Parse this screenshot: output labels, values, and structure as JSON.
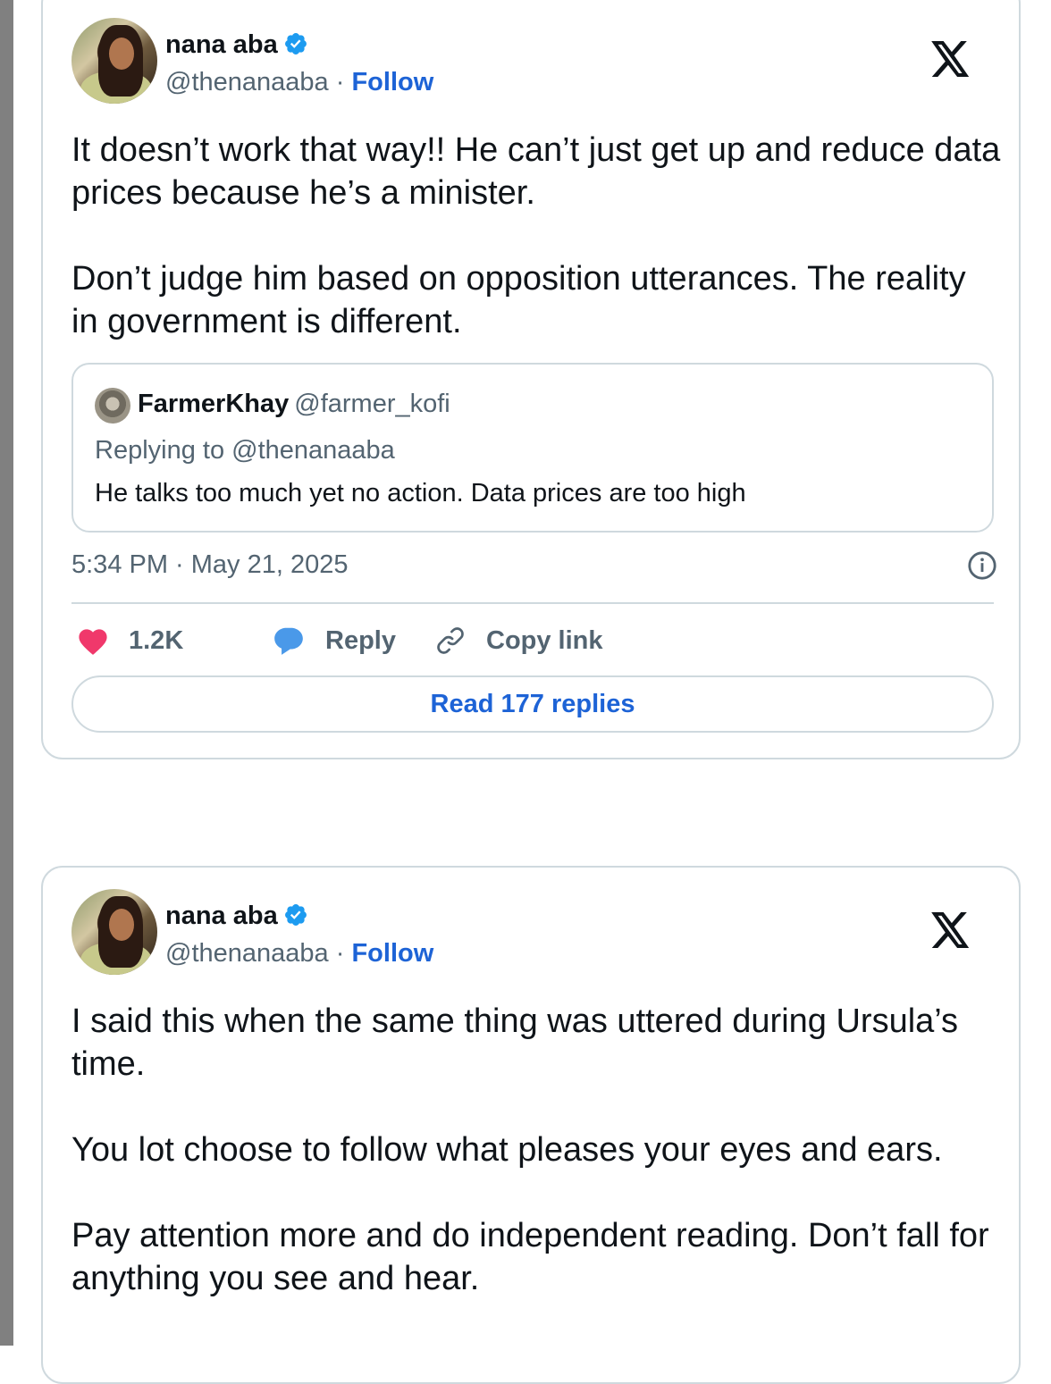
{
  "colors": {
    "link": "#1d63d6",
    "like": "#f0386b",
    "reply_bubble": "#4a99e9",
    "muted": "#536471"
  },
  "tweets": [
    {
      "author_name": "nana aba",
      "handle": "@thenanaaba",
      "separator": "·",
      "follow_label": "Follow",
      "paragraphs": [
        "It doesn’t work that way!! He can’t just get up and reduce data prices because he’s a minister.",
        "Don’t judge him based on opposition utterances. The reality in government is different."
      ],
      "quote": {
        "name": "FarmerKhay",
        "handle": "@farmer_kofi",
        "replying_to": "Replying to @thenanaaba",
        "text": "He talks too much yet no action. Data prices are too high"
      },
      "timestamp": "5:34 PM · May 21, 2025",
      "likes": "1.2K",
      "reply_label": "Reply",
      "copy_link_label": "Copy link",
      "read_replies_label": "Read 177 replies"
    },
    {
      "author_name": "nana aba",
      "handle": "@thenanaaba",
      "separator": "·",
      "follow_label": "Follow",
      "paragraphs": [
        "I said this when the same thing was uttered during Ursula’s time.",
        "You lot choose to follow what pleases your eyes and ears.",
        "Pay attention more and do independent reading. Don’t fall for anything you see and hear."
      ]
    }
  ],
  "icons": {
    "verified": "verified-badge-icon",
    "x_logo": "x-logo-icon",
    "info": "info-icon",
    "like": "heart-icon",
    "reply": "speech-bubble-icon",
    "copy": "link-icon"
  }
}
